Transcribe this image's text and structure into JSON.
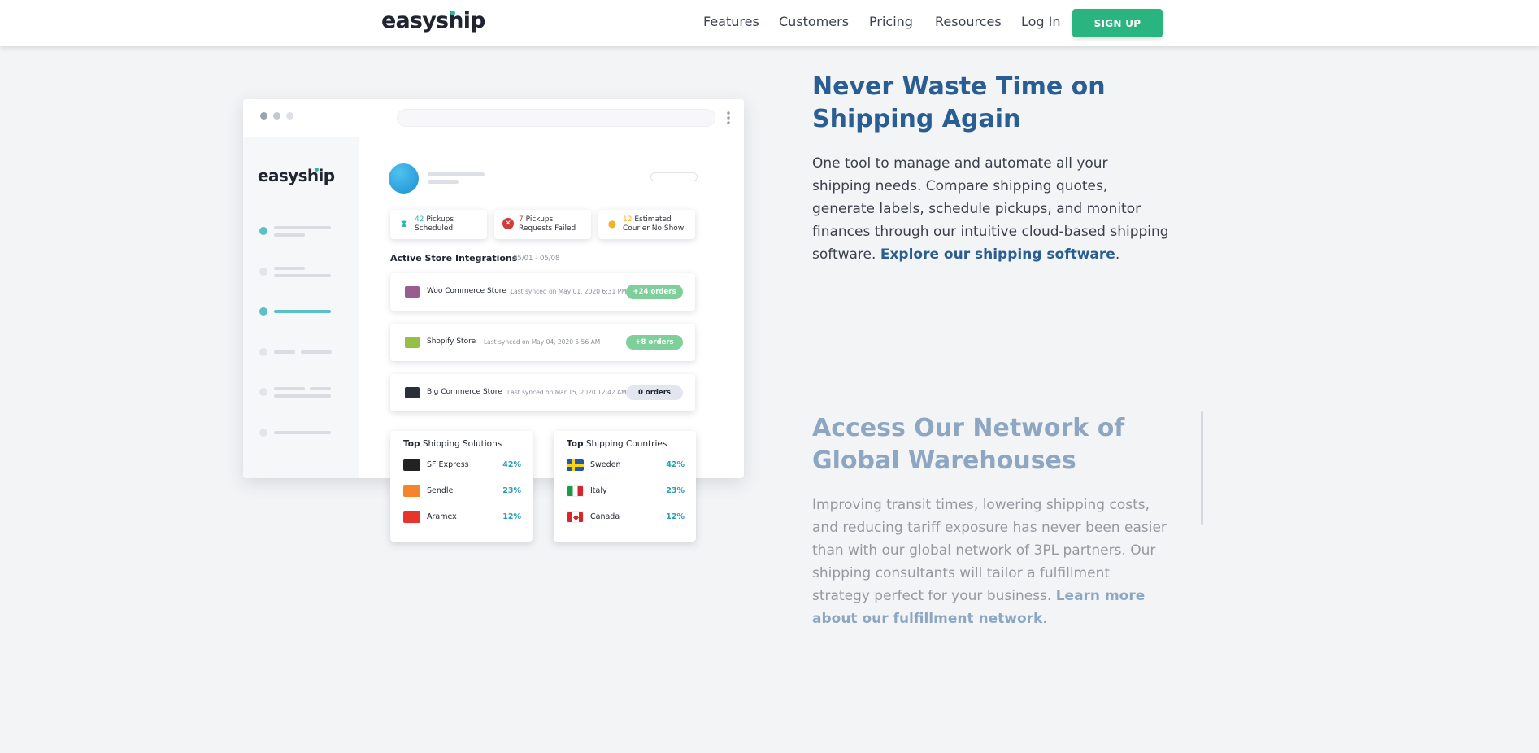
{
  "nav": {
    "logo": "easyship",
    "links": [
      "Features",
      "Customers",
      "Pricing",
      "Resources",
      "Log In"
    ],
    "signup": "SIGN UP"
  },
  "mockup": {
    "logo": "easyship",
    "stats": [
      {
        "num": "42",
        "line1": "Pickups",
        "line2": "Scheduled",
        "icon": "hourglass-icon"
      },
      {
        "num": "7",
        "line1": "Pickups",
        "line2": "Requests Failed",
        "icon": "error-icon"
      },
      {
        "num": "12",
        "line1": "Estimated",
        "line2": "Courier No Show",
        "icon": "user-warning-icon"
      }
    ],
    "section_title": "Active Store Integrations",
    "section_date": "05/01 - 05/08",
    "stores": [
      {
        "name": "Woo Commerce Store",
        "sync": "Last synced on May 01, 2020 6:31 PM",
        "badge": "+24 orders",
        "badge_color": "#7fcf9a",
        "icon_color": "#9b5c8f"
      },
      {
        "name": "Shopify Store",
        "sync": "Last synced on May 04, 2020 5:56 AM",
        "badge": "+8 orders",
        "badge_color": "#7fcf9a",
        "icon_color": "#95bf47"
      },
      {
        "name": "Big Commerce Store",
        "sync": "Last synced on Mar 15, 2020 12:42 AM",
        "badge": "0 orders",
        "badge_color": "#e3e6ee",
        "icon_color": "#2a2f3a"
      }
    ],
    "top_solutions": {
      "title_bold": "Top",
      "title_rest": " Shipping Solutions",
      "rows": [
        {
          "name": "SF Express",
          "pct": "42%",
          "color": "#222222"
        },
        {
          "name": "Sendle",
          "pct": "23%",
          "color": "#f5842b"
        },
        {
          "name": "Aramex",
          "pct": "12%",
          "color": "#e8352b"
        }
      ]
    },
    "top_countries": {
      "title_bold": "Top",
      "title_rest": " Shipping Countries",
      "rows": [
        {
          "name": "Sweden",
          "pct": "42%"
        },
        {
          "name": "Italy",
          "pct": "23%"
        },
        {
          "name": "Canada",
          "pct": "12%"
        }
      ]
    }
  },
  "feature1": {
    "heading": "Never Waste Time on Shipping Again",
    "body": "One tool to manage and automate all your shipping needs. Compare shipping quotes, generate labels, schedule pickups, and monitor finances through our intuitive cloud-based shipping software.",
    "link": "Explore our shipping software",
    "after": "."
  },
  "feature2": {
    "heading": "Access Our Network of Global Warehouses",
    "body": "Improving transit times, lowering shipping costs, and reducing tariff exposure has never been easier than with our global network of 3PL partners. Our shipping consultants will tailor a fulfillment strategy perfect for your business.",
    "link": "Learn more about our fulfillment network",
    "after": "."
  },
  "colors": {
    "brand_green": "#2ab580",
    "heading_blue": "#2a5d92",
    "accent_teal": "#2ab7a9"
  }
}
